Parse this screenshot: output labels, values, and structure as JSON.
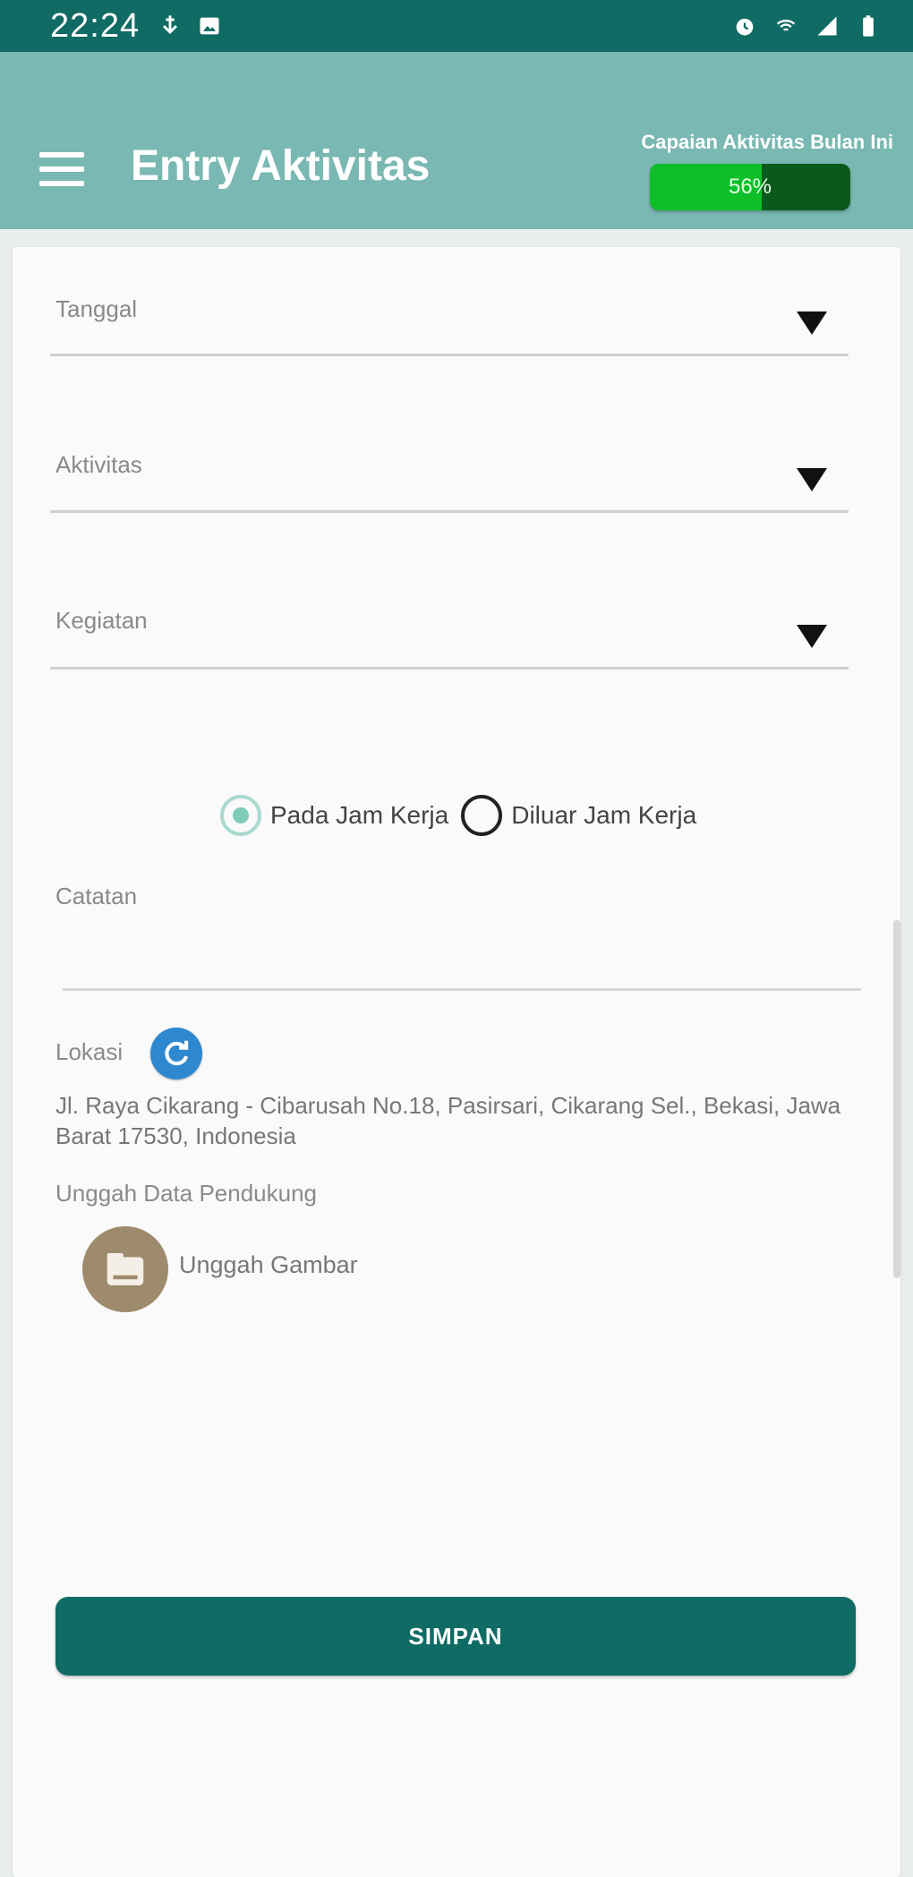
{
  "status_bar": {
    "time": "22:24",
    "left_icons": [
      "usb-icon",
      "image-icon"
    ],
    "right_icons": [
      "alarm-icon",
      "wifi-call-icon",
      "signal-icon",
      "battery-icon"
    ]
  },
  "app_bar": {
    "title": "Entry Aktivitas",
    "achievement_label": "Capaian Aktivitas Bulan Ini",
    "achievement_percent_text": "56%",
    "achievement_fraction": 0.56
  },
  "form": {
    "tanggal_label": "Tanggal",
    "aktivitas_label": "Aktivitas",
    "kegiatan_label": "Kegiatan",
    "radio_options": [
      {
        "label": "Pada Jam Kerja",
        "selected": true
      },
      {
        "label": "Diluar Jam Kerja",
        "selected": false
      }
    ],
    "catatan_label": "Catatan",
    "lokasi_label": "Lokasi",
    "address": "Jl. Raya Cikarang - Cibarusah No.18, Pasirsari, Cikarang Sel., Bekasi, Jawa Barat 17530, Indonesia",
    "upload_section_label": "Unggah Data Pendukung",
    "upload_button_label": "Unggah Gambar",
    "save_label": "SIMPAN"
  },
  "colors": {
    "primary_dark": "#0f6b63",
    "app_bar": "#7ab8b3",
    "progress_fill": "#0fbf2a",
    "location_button": "#2e88cf",
    "upload_button": "#9e8a6c"
  }
}
